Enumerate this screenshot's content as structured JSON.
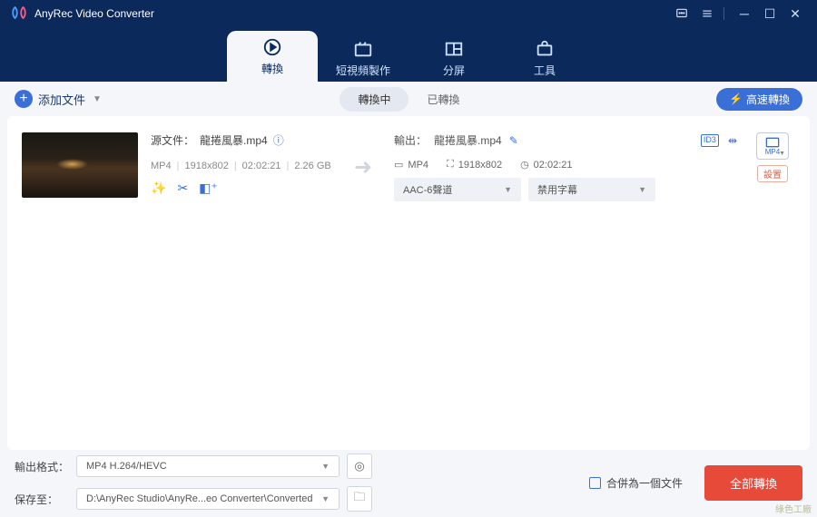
{
  "title": "AnyRec Video Converter",
  "nav": {
    "convert": "轉換",
    "mv": "短視頻製作",
    "collage": "分屏",
    "toolbox": "工具"
  },
  "toolbar": {
    "add": "添加文件",
    "converting": "轉換中",
    "converted": "已轉換",
    "speed": "高速轉換"
  },
  "file": {
    "src_label": "源文件：",
    "src_name": "龍捲風暴.mp4",
    "meta_fmt": "MP4",
    "meta_res": "1918x802",
    "meta_dur": "02:02:21",
    "meta_size": "2.26 GB",
    "out_label": "輸出：",
    "out_name": "龍捲風暴.mp4",
    "out_fmt": "MP4",
    "out_res": "1918x802",
    "out_dur": "02:02:21",
    "audio_sel": "AAC-6聲道",
    "sub_sel": "禁用字幕",
    "fmt_badge": "MP4",
    "fmt_action": "設置"
  },
  "bottom": {
    "fmt_label": "輸出格式：",
    "fmt_value": "MP4 H.264/HEVC",
    "save_label": "保存至：",
    "save_value": "D:\\AnyRec Studio\\AnyRe...eo Converter\\Converted",
    "merge": "合併為一個文件",
    "convert": "全部轉換"
  },
  "watermark": "綠色工廠"
}
